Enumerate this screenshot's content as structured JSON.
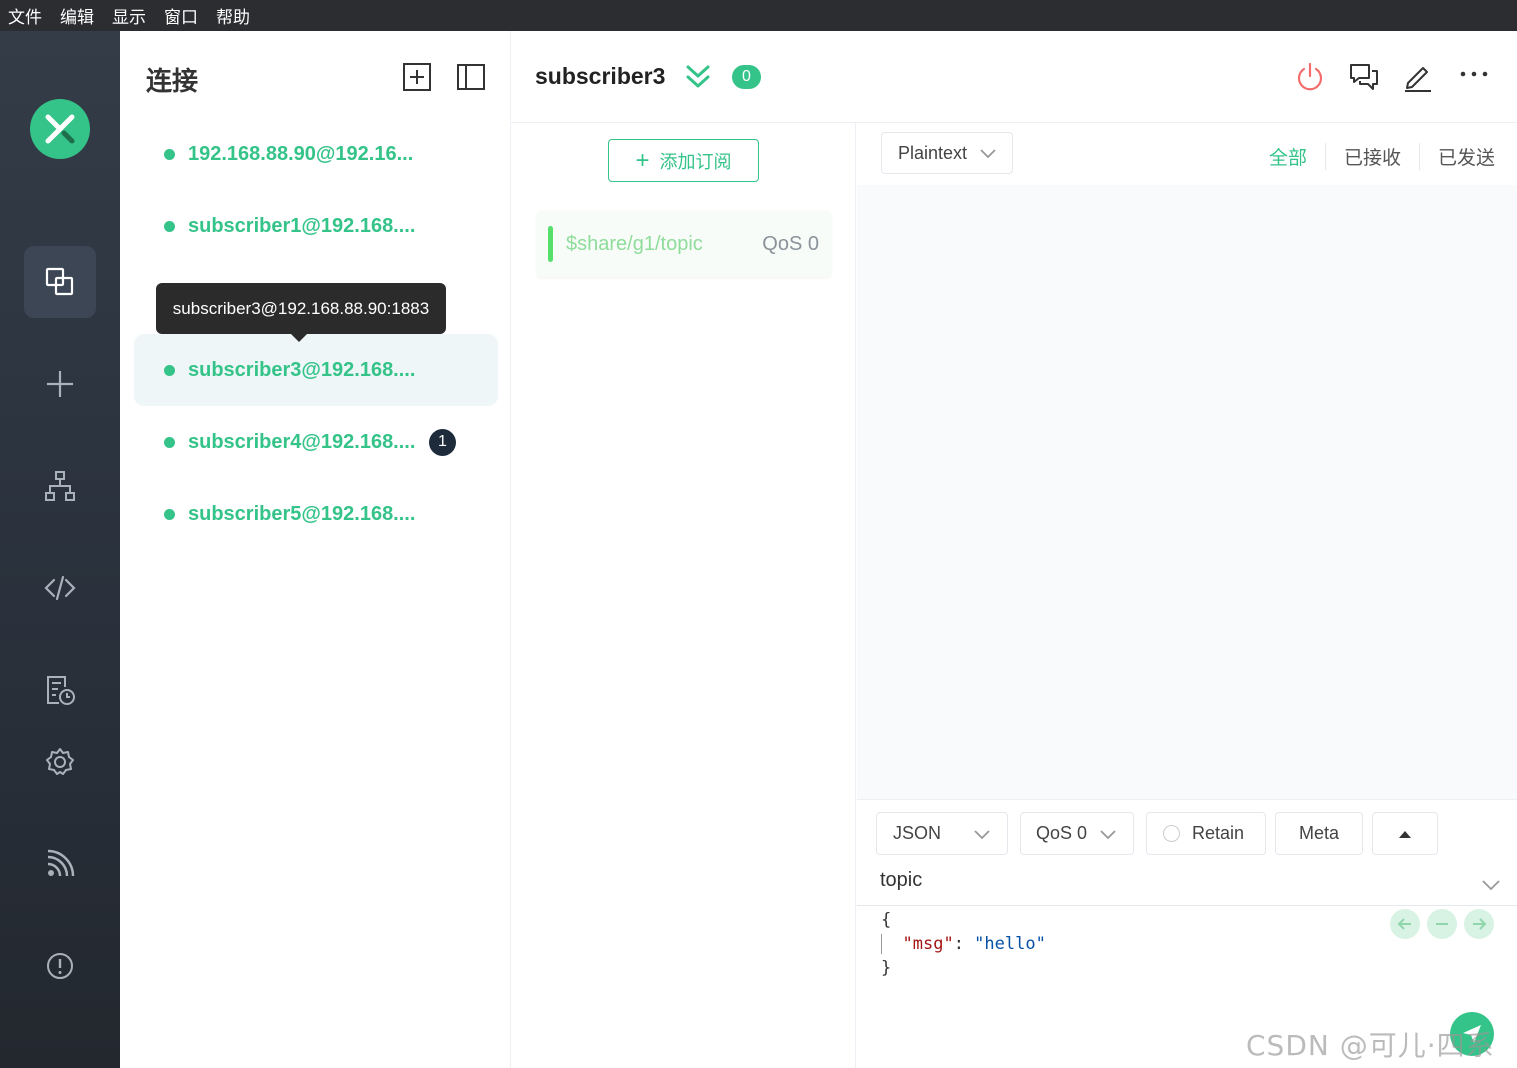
{
  "menubar": {
    "items": [
      "文件",
      "编辑",
      "显示",
      "窗口",
      "帮助"
    ]
  },
  "leftnav": {
    "logo": "mqttx-logo",
    "items": [
      {
        "icon": "connections-icon",
        "active": true
      },
      {
        "icon": "plus-icon"
      },
      {
        "icon": "topology-icon"
      },
      {
        "icon": "script-icon"
      },
      {
        "icon": "log-icon"
      },
      {
        "icon": "gear-icon"
      },
      {
        "icon": "rss-icon"
      },
      {
        "icon": "info-icon"
      }
    ]
  },
  "connections": {
    "title": "连接",
    "items": [
      {
        "label": "192.168.88.90@192.16...",
        "status": "connected",
        "unread": null
      },
      {
        "label": "subscriber1@192.168....",
        "status": "connected",
        "unread": null
      },
      {
        "label": "subscriber3@192.168....",
        "status": "connected",
        "unread": null,
        "selected": true
      },
      {
        "label": "subscriber4@192.168....",
        "status": "connected",
        "unread": "1"
      },
      {
        "label": "subscriber5@192.168....",
        "status": "connected",
        "unread": null
      }
    ],
    "tooltip": "subscriber3@192.168.88.90:1883"
  },
  "header": {
    "title": "subscriber3",
    "badge": "0",
    "actions": [
      "power-icon",
      "chat-icon",
      "edit-icon",
      "more-icon"
    ]
  },
  "subscriptions": {
    "add_label": "添加订阅",
    "items": [
      {
        "topic": "$share/g1/topic",
        "qos": "QoS 0",
        "color": "#55e06c"
      }
    ]
  },
  "messages": {
    "format": "Plaintext",
    "filters": [
      "全部",
      "已接收",
      "已发送"
    ],
    "active_filter": "全部"
  },
  "publish": {
    "payload_format": "JSON",
    "qos": "QoS 0",
    "retain_label": "Retain",
    "retain_checked": false,
    "meta_label": "Meta",
    "topic": "topic",
    "payload_lines": [
      "{",
      "\"msg\": \"hello\"",
      "}"
    ],
    "payload_key": "\"msg\"",
    "payload_value": "\"hello\""
  },
  "watermark": "CSDN @可儿·四系桜",
  "colors": {
    "accent": "#34c388",
    "nav_bg": "#2c3440",
    "menubar_bg": "#2b2d31",
    "danger": "#f56c6c"
  }
}
